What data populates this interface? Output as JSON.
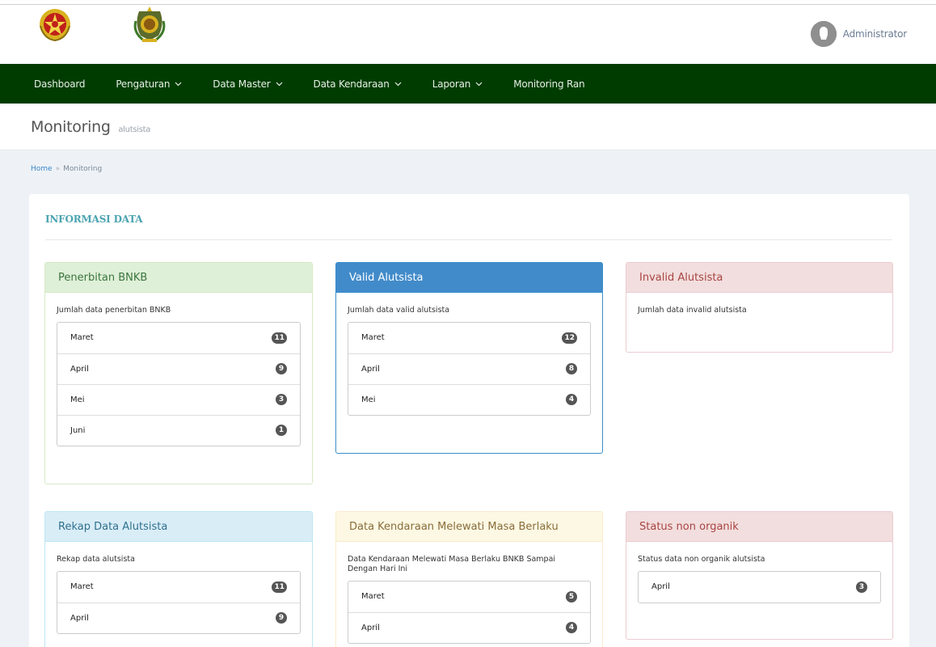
{
  "header": {
    "user_name": "Administrator"
  },
  "nav": {
    "items": [
      {
        "label": "Dashboard",
        "dropdown": false
      },
      {
        "label": "Pengaturan",
        "dropdown": true
      },
      {
        "label": "Data Master",
        "dropdown": true
      },
      {
        "label": "Data Kendaraan",
        "dropdown": true
      },
      {
        "label": "Laporan",
        "dropdown": true
      },
      {
        "label": "Monitoring Ran",
        "dropdown": false
      }
    ]
  },
  "page": {
    "title": "Monitoring",
    "subtitle": "alutsista"
  },
  "breadcrumb": {
    "home": "Home",
    "separator": "»",
    "current": "Monitoring"
  },
  "panel": {
    "title": "INFORMASI DATA"
  },
  "boxes": {
    "penerbitan": {
      "title": "Penerbitan BNKB",
      "desc": "Jumlah data penerbitan BNKB",
      "rows": [
        {
          "label": "Maret",
          "count": "11"
        },
        {
          "label": "April",
          "count": "9"
        },
        {
          "label": "Mei",
          "count": "3"
        },
        {
          "label": "Juni",
          "count": "1"
        }
      ]
    },
    "valid": {
      "title": "Valid Alutsista",
      "desc": "Jumlah data valid alutsista",
      "rows": [
        {
          "label": "Maret",
          "count": "12"
        },
        {
          "label": "April",
          "count": "8"
        },
        {
          "label": "Mei",
          "count": "4"
        }
      ]
    },
    "invalid": {
      "title": "Invalid Alutsista",
      "desc": "Jumlah data invalid alutsista"
    },
    "rekap": {
      "title": "Rekap Data Alutsista",
      "desc": "Rekap data alutsista",
      "rows": [
        {
          "label": "Maret",
          "count": "11"
        },
        {
          "label": "April",
          "count": "9"
        }
      ]
    },
    "kendaraan": {
      "title": "Data Kendaraan Melewati Masa Berlaku",
      "desc": "Data Kendaraan Melewati Masa Berlaku BNKB Sampai Dengan Hari Ini",
      "rows": [
        {
          "label": "Maret",
          "count": "5"
        },
        {
          "label": "April",
          "count": "4"
        }
      ]
    },
    "nonorganik": {
      "title": "Status non organik",
      "desc": "Status data non organik alutsista",
      "rows": [
        {
          "label": "April",
          "count": "3"
        }
      ]
    }
  },
  "colors": {
    "navbar": "#003c00",
    "panel_title": "#4aa3b0",
    "content_bg": "#eef2f6"
  }
}
